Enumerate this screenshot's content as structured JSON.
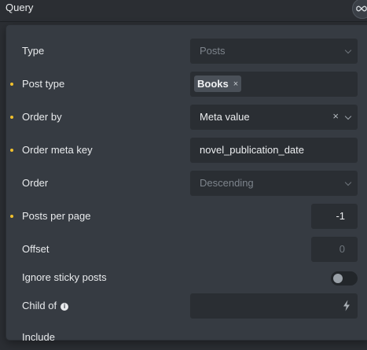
{
  "header": {
    "title": "Query",
    "loop_icon": "infinity-icon"
  },
  "fields": {
    "type": {
      "label": "Type",
      "value": "Posts"
    },
    "post_type": {
      "label": "Post type",
      "tag": "Books",
      "tag_remove": "×"
    },
    "order_by": {
      "label": "Order by",
      "value": "Meta value",
      "clear": "×"
    },
    "order_meta_key": {
      "label": "Order meta key",
      "value": "novel_publication_date"
    },
    "order": {
      "label": "Order",
      "value": "Descending"
    },
    "posts_per_page": {
      "label": "Posts per page",
      "value": "-1"
    },
    "offset": {
      "label": "Offset",
      "value": "0"
    },
    "ignore_sticky": {
      "label": "Ignore sticky posts",
      "checked": false
    },
    "child_of": {
      "label": "Child of",
      "info": "i"
    },
    "include": {
      "label": "Include"
    }
  },
  "colors": {
    "modified_dot": "#f1c02d",
    "panel": "#363b42",
    "control": "#2a2e33"
  }
}
